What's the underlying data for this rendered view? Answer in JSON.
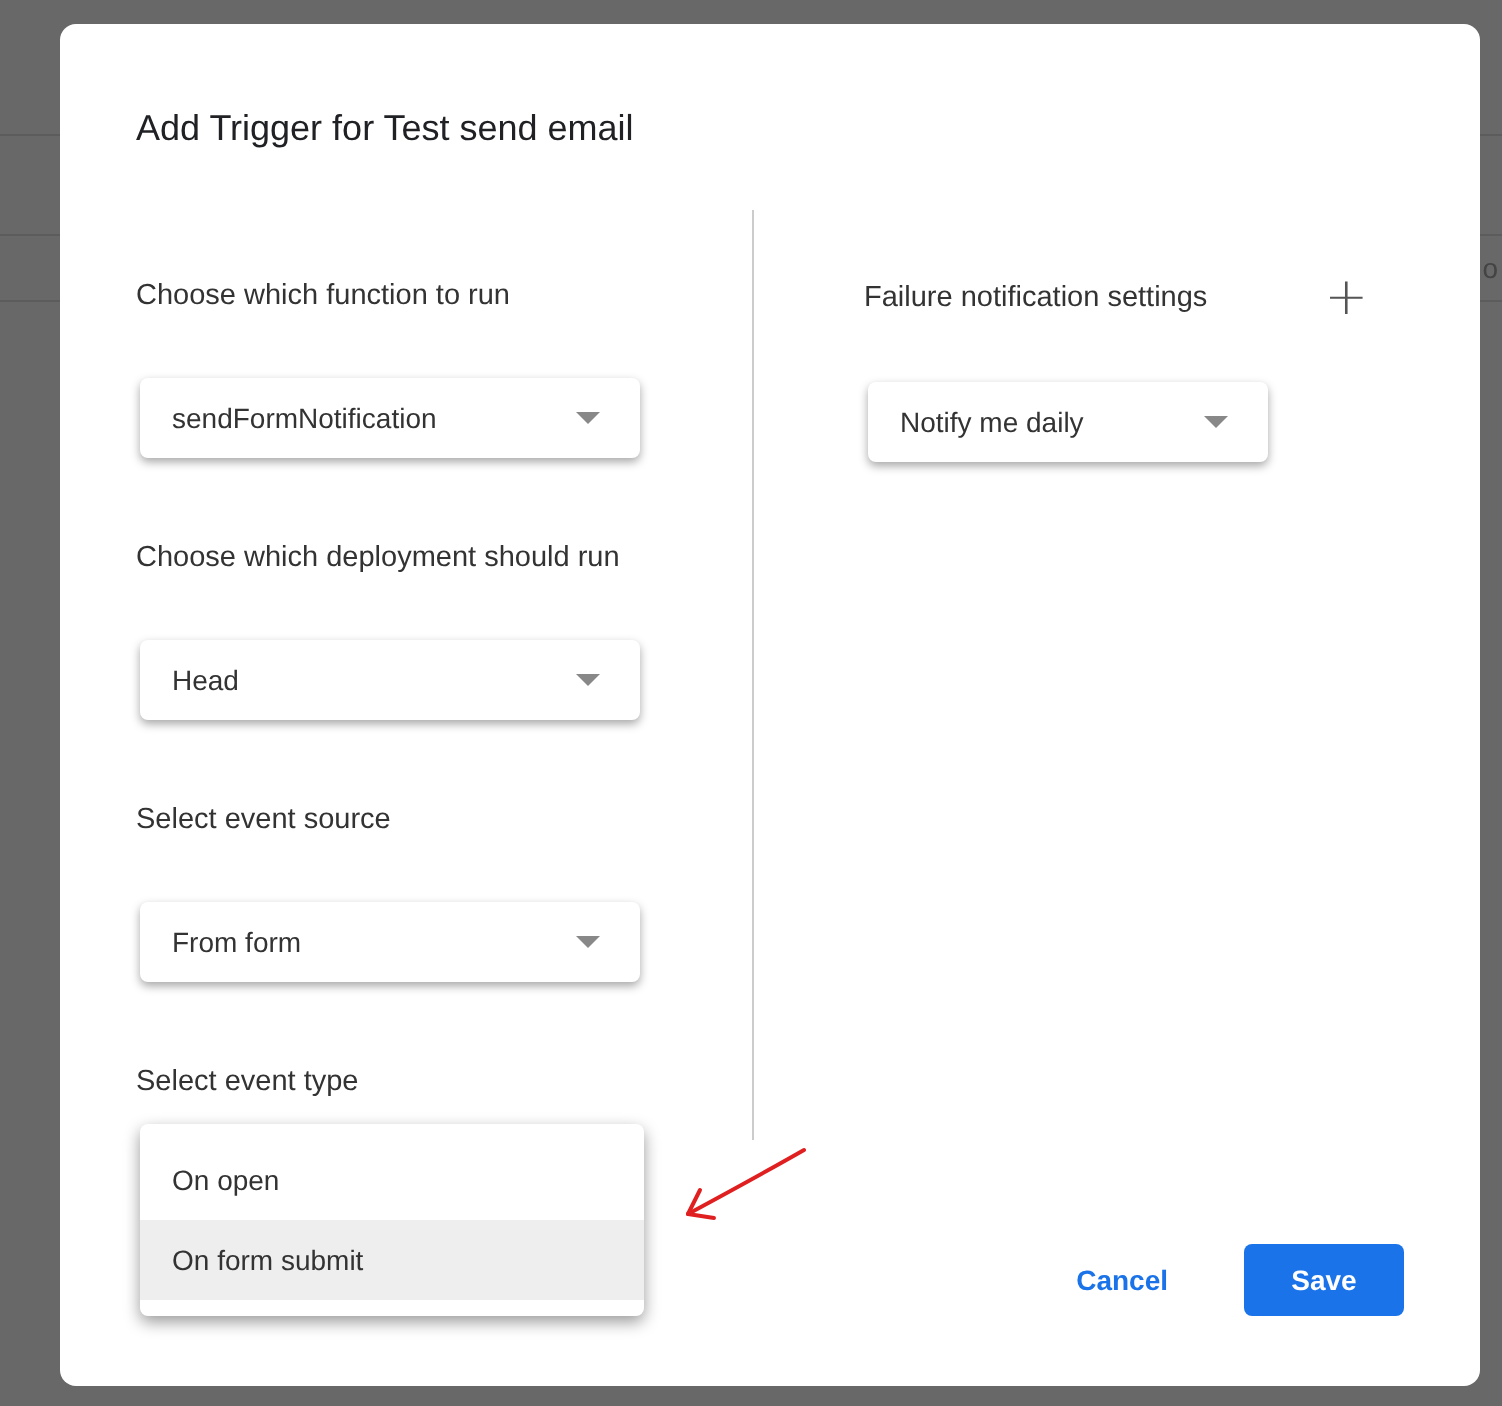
{
  "background": {
    "fragment": "o"
  },
  "dialog": {
    "title": "Add Trigger for Test send email",
    "fields": [
      {
        "kind": "select",
        "label": "Choose which function to run",
        "value": "sendFormNotification"
      },
      {
        "kind": "select",
        "label": "Choose which deployment should run",
        "value": "Head"
      },
      {
        "kind": "select",
        "label": "Select event source",
        "value": "From form"
      },
      {
        "kind": "menu",
        "label": "Select event type",
        "options": [
          {
            "label": "On open",
            "selected": false
          },
          {
            "label": "On form submit",
            "selected": true
          }
        ]
      }
    ],
    "failure": {
      "label": "Failure notification settings",
      "add": "+",
      "value": "Notify me daily"
    },
    "buttons": [
      {
        "kind": "text",
        "label": "Cancel"
      },
      {
        "kind": "primary",
        "label": "Save"
      }
    ]
  }
}
